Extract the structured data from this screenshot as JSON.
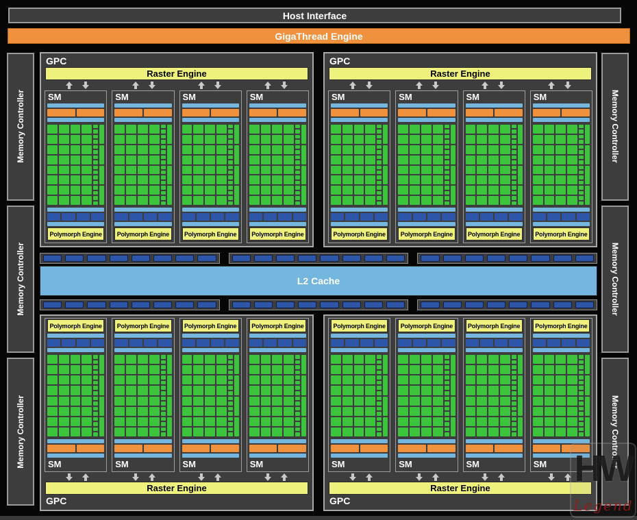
{
  "bars": {
    "host_interface": "Host Interface",
    "gigathread": "GigaThread Engine"
  },
  "memory": {
    "label": "Memory Controller",
    "left_count": 3,
    "right_count": 3
  },
  "gpc": {
    "label": "GPC",
    "raster_engine": "Raster Engine",
    "sm_label": "SM",
    "polymorph_engine": "Polymorph Engine",
    "sms_per_gpc": 4,
    "top_count": 2,
    "bottom_count": 2
  },
  "sm_detail": {
    "core_rows": 8,
    "core_cols": 4,
    "small_cells": 16,
    "tall_cells": 4,
    "orange_blocks": 2,
    "darkblue_blocks": 4
  },
  "l2": {
    "label": "L2 Cache",
    "strips_per_row": 3,
    "segments_per_strip": 8
  },
  "watermark": {
    "line1": "HW",
    "line2": "Legend"
  },
  "colors": {
    "orange": "#F0913D",
    "yellow": "#EEF17B",
    "light_blue": "#74B6DE",
    "dark_blue": "#2D55A8",
    "green": "#3CC43C",
    "panel": "#3D3D3D",
    "background": "#060606"
  }
}
